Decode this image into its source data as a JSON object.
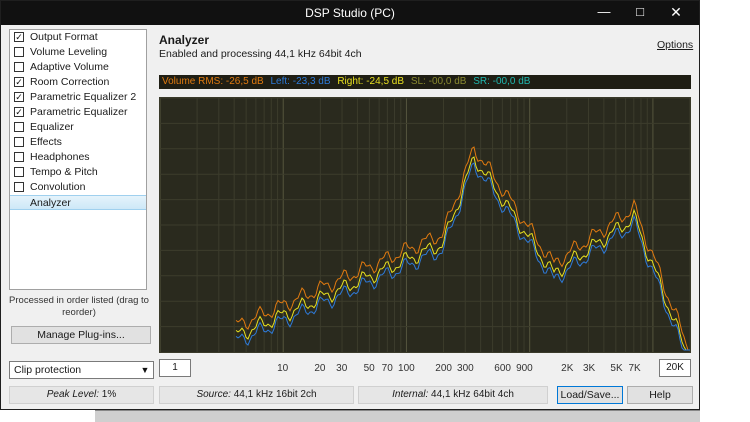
{
  "window": {
    "title": "DSP Studio (PC)"
  },
  "plugins": [
    {
      "label": "Output Format",
      "checked": true
    },
    {
      "label": "Volume Leveling",
      "checked": false
    },
    {
      "label": "Adaptive Volume",
      "checked": false
    },
    {
      "label": "Room Correction",
      "checked": true
    },
    {
      "label": "Parametric Equalizer 2",
      "checked": true
    },
    {
      "label": "Parametric Equalizer",
      "checked": true
    },
    {
      "label": "Equalizer",
      "checked": false
    },
    {
      "label": "Effects",
      "checked": false
    },
    {
      "label": "Headphones",
      "checked": false
    },
    {
      "label": "Tempo & Pitch",
      "checked": false
    },
    {
      "label": "Convolution",
      "checked": false
    },
    {
      "label": "Analyzer",
      "checked": null,
      "selected": true
    }
  ],
  "sidebar": {
    "processed_note": "Processed in order listed (drag to reorder)",
    "manage_button": "Manage Plug-ins...",
    "clip_select": "Clip protection"
  },
  "header": {
    "title": "Analyzer",
    "subtitle": "Enabled and processing 44,1 kHz 64bit 4ch",
    "options_link": "Options"
  },
  "levels": {
    "volume_rms": "Volume RMS: -26,5 dB",
    "left": "Left: -23,3 dB",
    "right": "Right: -24,5 dB",
    "sl": "SL: -00,0 dB",
    "sr": "SR: -00,0 dB",
    "colors": {
      "volume": "#e07a10",
      "left": "#2e7ad8",
      "right": "#e8e020",
      "sl": "#8a8a30",
      "sr": "#20b8b0"
    }
  },
  "frequency_axis": {
    "min_box": "1",
    "max_box": "20K",
    "labels": [
      "10",
      "20",
      "30",
      "50",
      "70",
      "100",
      "200",
      "300",
      "600",
      "900",
      "2K",
      "3K",
      "5K",
      "7K"
    ]
  },
  "status": {
    "peak_label": "Peak Level:",
    "peak_value": "1%",
    "source_label": "Source:",
    "source_value": "44,1 kHz 16bit 2ch",
    "internal_label": "Internal:",
    "internal_value": "44,1 kHz 64bit 4ch"
  },
  "buttons": {
    "load_save": "Load/Save...",
    "help": "Help"
  }
}
